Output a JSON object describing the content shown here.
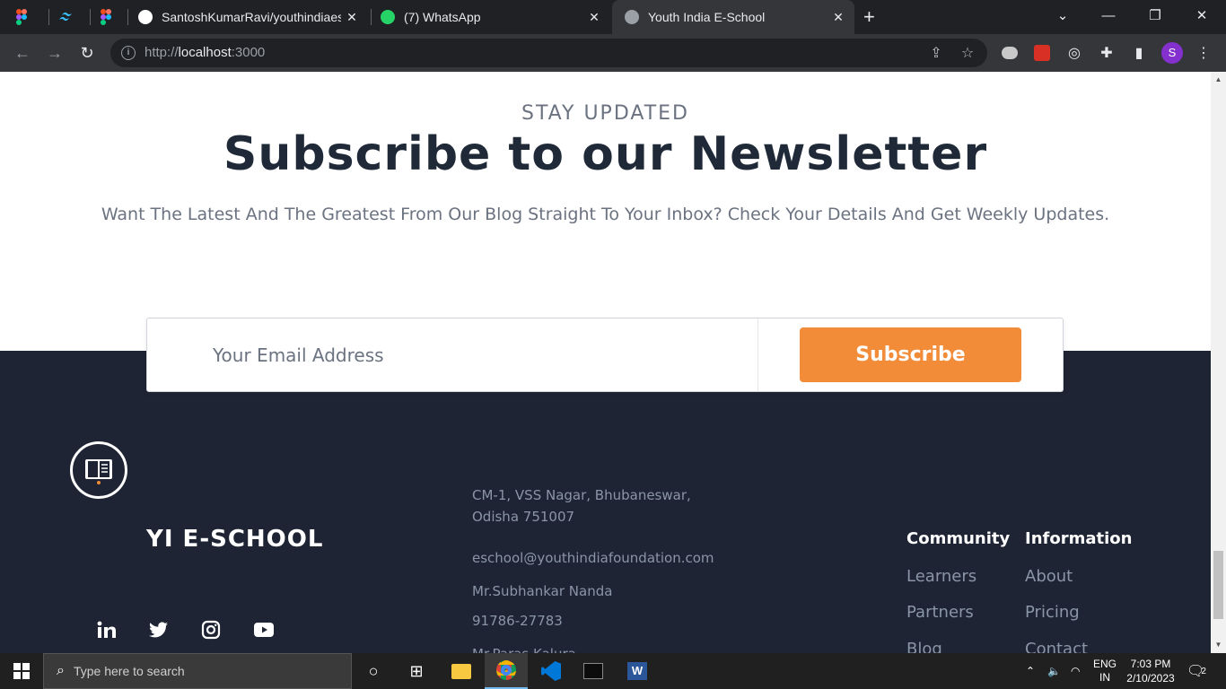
{
  "browser": {
    "tabs": [
      {
        "label": "",
        "favicon": "figma-icon"
      },
      {
        "label": "",
        "favicon": "tailwind-icon"
      },
      {
        "label": "",
        "favicon": "figma-icon"
      },
      {
        "label": "SantoshKumarRavi/youthindiaeschool",
        "favicon": "github-icon"
      },
      {
        "label": "(7) WhatsApp",
        "favicon": "whatsapp-icon"
      },
      {
        "label": "Youth India E-School",
        "favicon": "site-icon",
        "active": true
      }
    ],
    "url_scheme": "http://",
    "url_host": "localhost",
    "url_port": ":3000",
    "profile_initial": "S"
  },
  "newsletter": {
    "kicker": "STAY UPDATED",
    "headline": "Subscribe to our Newsletter",
    "subtext": "Want The Latest And The Greatest From Our Blog Straight To Your Inbox? Check Your Details And Get Weekly Updates.",
    "email_placeholder": "Your Email Address",
    "button_label": "Subscribe",
    "accent": "#f28c38"
  },
  "footer": {
    "brand": "YI E-SCHOOL",
    "address_line1": "CM-1, VSS Nagar, Bhubaneswar,",
    "address_line2": "Odisha 751007",
    "email": "eschool@youthindiafoundation.com",
    "contact_name": "Mr.Subhankar Nanda",
    "phone": "91786-27783",
    "contact_name_2": "Mr.Paras Kalura",
    "community": {
      "heading": "Community",
      "links": [
        "Learners",
        "Partners",
        "Blog"
      ]
    },
    "information": {
      "heading": "Information",
      "links": [
        "About",
        "Pricing",
        "Contact"
      ]
    },
    "background": "#1e2433"
  },
  "taskbar": {
    "search_placeholder": "Type here to search",
    "language": "ENG",
    "region": "IN",
    "time": "7:03 PM",
    "date": "2/10/2023",
    "notifications": "2"
  }
}
